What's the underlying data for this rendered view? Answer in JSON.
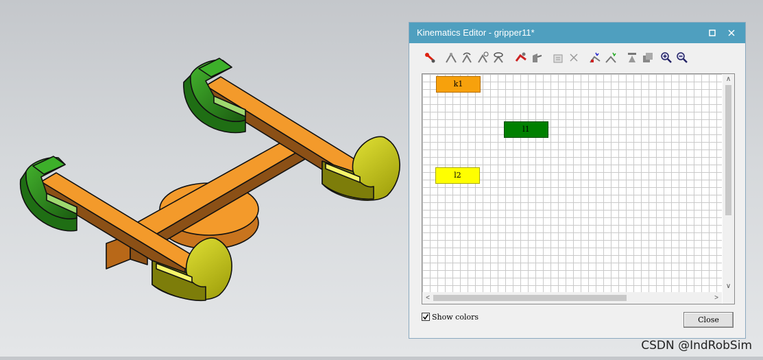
{
  "window": {
    "title": "Kinematics Editor -  gripper11*"
  },
  "toolbar": {
    "buttons": [
      {
        "icon": "create-link-icon"
      },
      {
        "icon": "create-prismatic-joint-icon"
      },
      {
        "icon": "create-revolute-joint-icon"
      },
      {
        "icon": "create-joint-dependency-icon"
      },
      {
        "icon": "create-cam-joint-icon"
      },
      {
        "icon": "create-crank-icon"
      },
      {
        "icon": "create-lock-joint-icon"
      },
      {
        "icon": "properties-icon"
      },
      {
        "icon": "delete-icon"
      },
      {
        "icon": "set-base-link-icon"
      },
      {
        "icon": "set-tool-frame-icon"
      },
      {
        "icon": "open-pose-editor-icon"
      },
      {
        "icon": "joint-list-icon"
      },
      {
        "icon": "zoom-in-icon"
      },
      {
        "icon": "zoom-out-icon"
      }
    ]
  },
  "nodes": [
    {
      "label": "k1",
      "fill": "#f7a10c"
    },
    {
      "label": "l1",
      "fill": "#008000"
    },
    {
      "label": "l2",
      "fill": "#ffff00"
    }
  ],
  "options": {
    "show_colors_label": "Show colors",
    "show_colors_checked": true
  },
  "buttons": {
    "close_label": "Close"
  },
  "watermark": "CSDN @IndRobSim",
  "colors": {
    "title_bar": "#4f9fbf",
    "orange_part": "#f39a2b",
    "green_part": "#2e8b1f",
    "yellow_part": "#d8d81a"
  }
}
